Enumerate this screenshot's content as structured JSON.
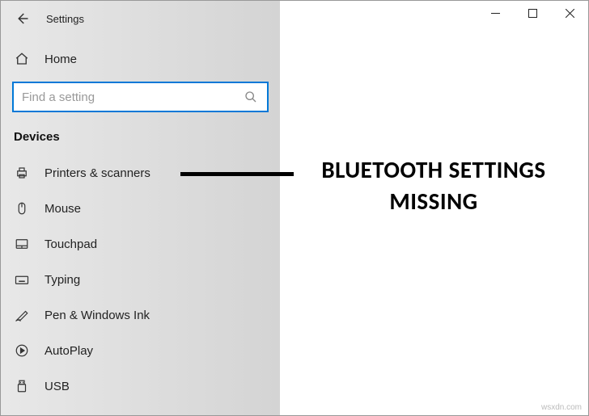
{
  "app_title": "Settings",
  "nav_home": "Home",
  "search_placeholder": "Find a setting",
  "section_label": "Devices",
  "items": {
    "printers": "Printers & scanners",
    "mouse": "Mouse",
    "touchpad": "Touchpad",
    "typing": "Typing",
    "pen": "Pen & Windows Ink",
    "autoplay": "AutoPlay",
    "usb": "USB"
  },
  "annotation_line1": "BLUETOOTH SETTINGS",
  "annotation_line2": "MISSING",
  "watermark": "wsxdn.com"
}
